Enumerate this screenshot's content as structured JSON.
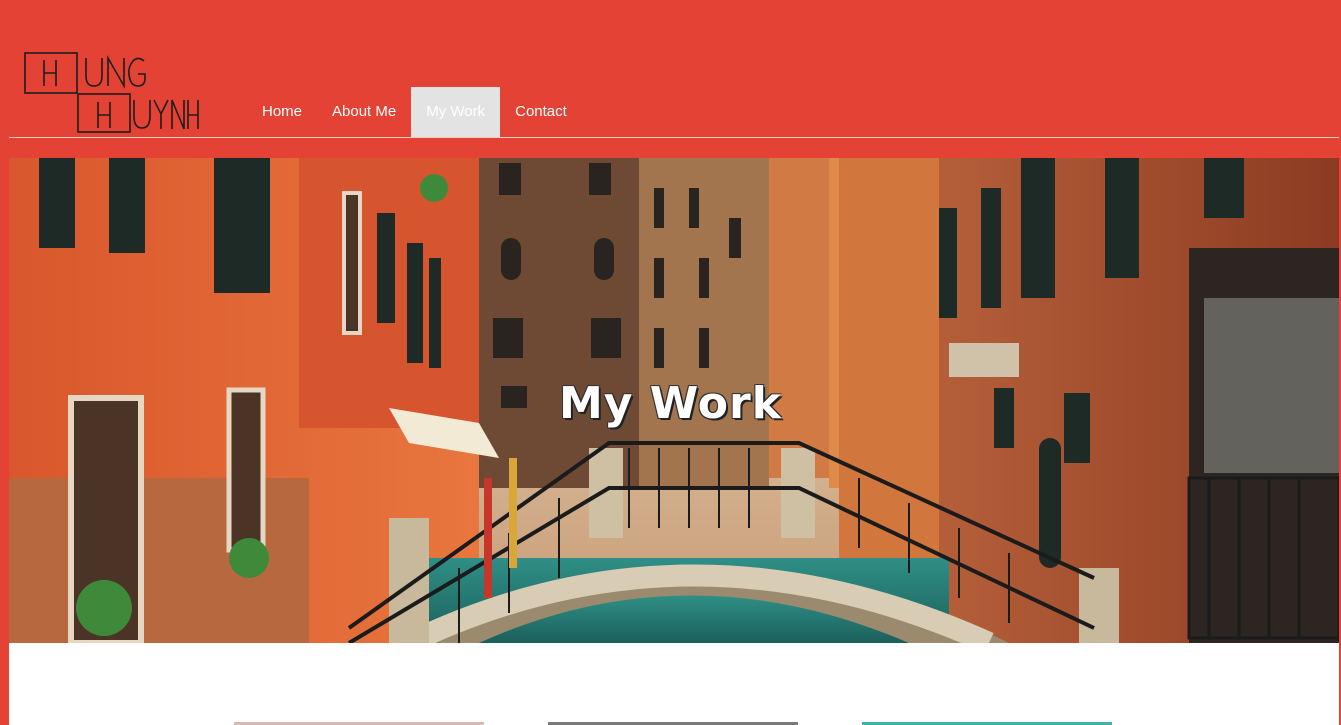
{
  "header": {
    "logo_text": {
      "line1": "HUNG",
      "line2": "HUYNH"
    },
    "nav": [
      {
        "label": "Home",
        "active": false
      },
      {
        "label": "About Me",
        "active": false
      },
      {
        "label": "My Work",
        "active": true
      },
      {
        "label": "Contact",
        "active": false
      }
    ]
  },
  "hero": {
    "title": "My Work",
    "image": "venice-canal-bridge"
  },
  "gallery": {
    "items": [
      {
        "name": "work-thumbnail-1",
        "color": "#d9b9b4"
      },
      {
        "name": "work-thumbnail-2",
        "color": "#7a7a7a"
      },
      {
        "name": "work-thumbnail-3",
        "color": "#3fb3a6"
      }
    ]
  },
  "colors": {
    "brand": "#e44234",
    "nav_active_bg": "#e3e3e3",
    "content_bg": "#ffffff"
  }
}
